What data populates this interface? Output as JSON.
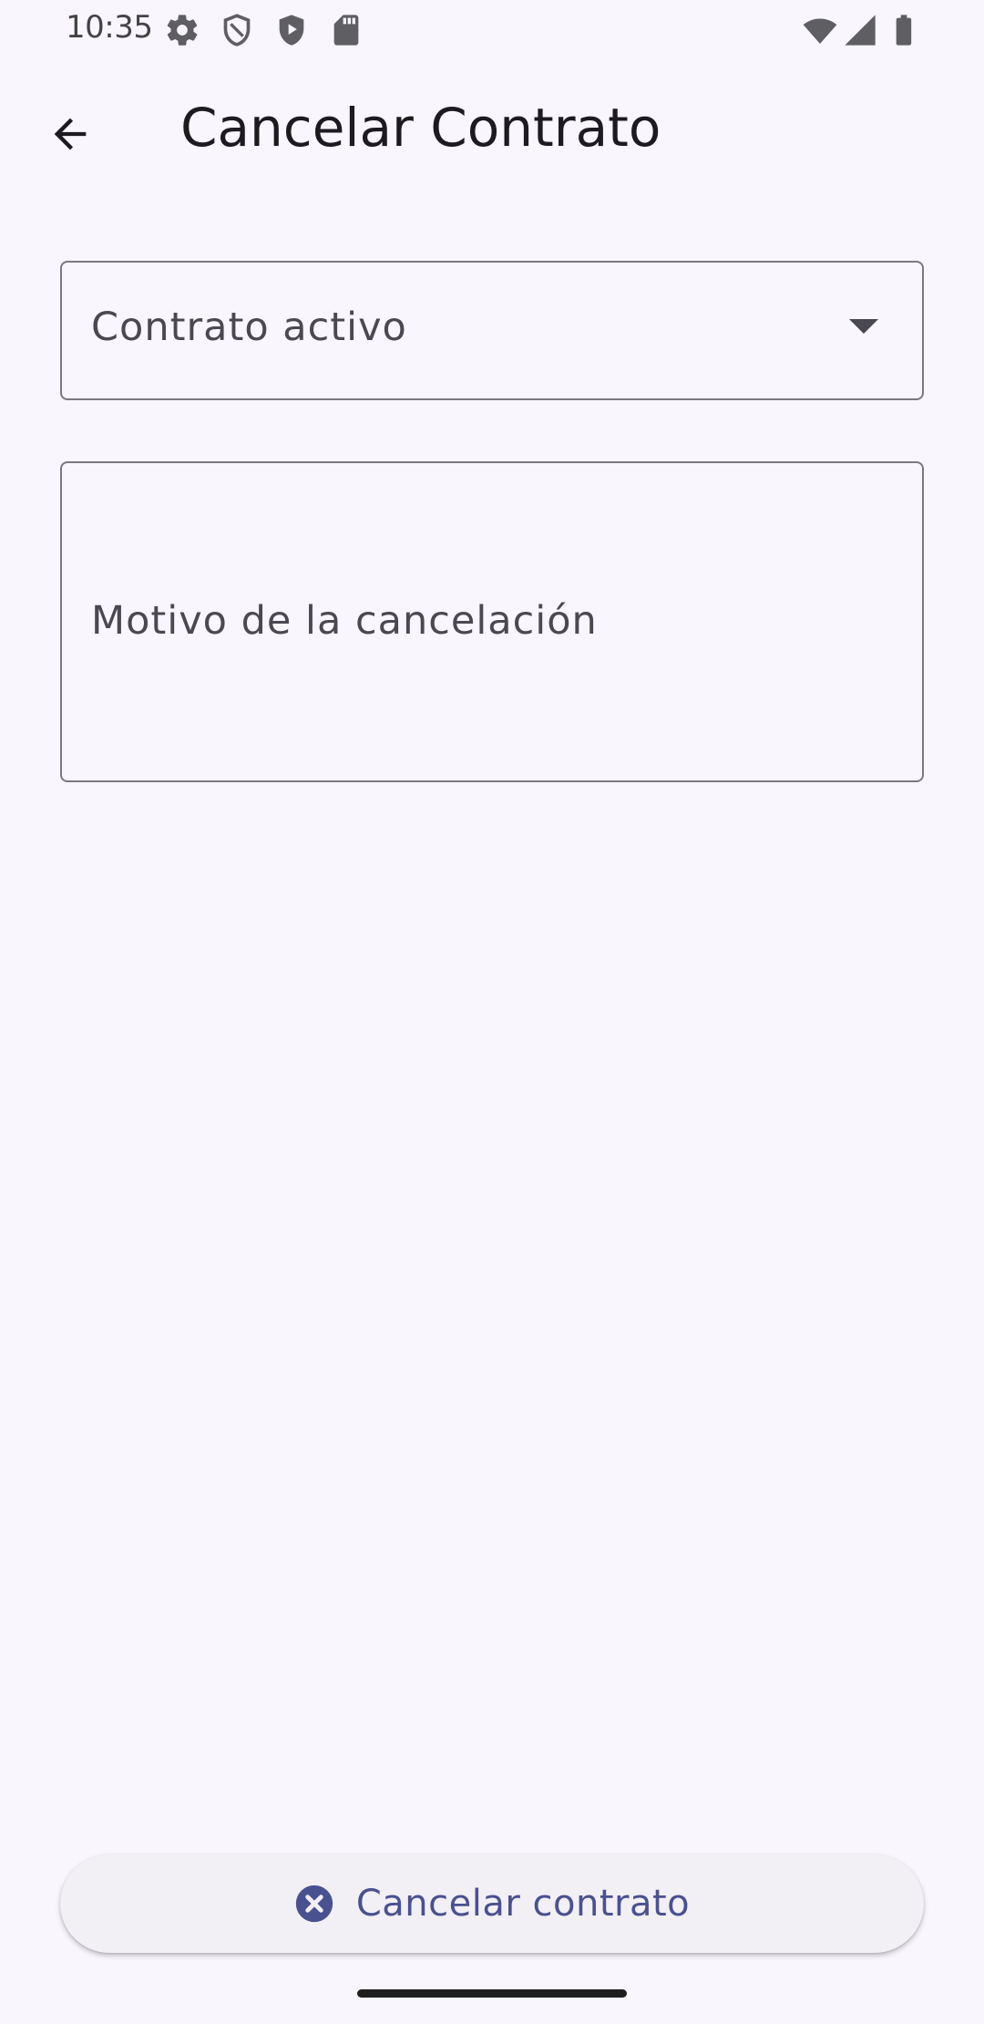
{
  "status_bar": {
    "time": "10:35",
    "left_icons": [
      "gear-icon",
      "shield-outline-icon",
      "shield-play-icon",
      "sd-card-icon"
    ],
    "right_icons": [
      "wifi-icon",
      "cellular-signal-icon",
      "battery-icon"
    ]
  },
  "app_bar": {
    "back_icon": "arrow-back-icon",
    "title": "Cancelar Contrato"
  },
  "form": {
    "contract_select": {
      "label": "Contrato activo",
      "icon": "dropdown-arrow-icon"
    },
    "reason_field": {
      "label": "Motivo de la cancelación"
    }
  },
  "bottom_button": {
    "label": "Cancelar contrato",
    "icon": "cancel-circle-icon"
  },
  "colors": {
    "background": "#f9f6fd",
    "outline": "#7a7880",
    "button_background": "#f2eff5",
    "accent": "#4a5190"
  }
}
